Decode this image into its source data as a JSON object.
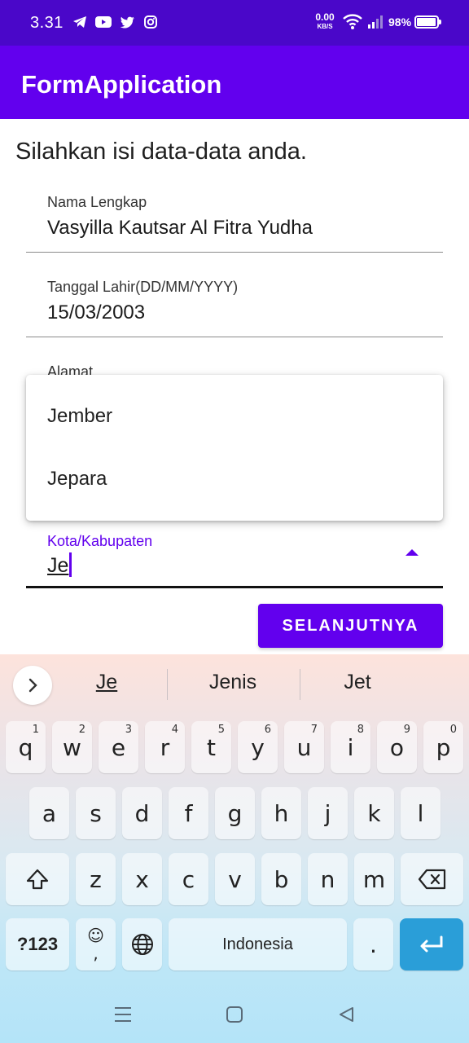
{
  "status_bar": {
    "time": "3.31",
    "net_speed_value": "0.00",
    "net_speed_unit": "KB/S",
    "battery": "98%",
    "icons": [
      "telegram-icon",
      "youtube-icon",
      "twitter-icon",
      "instagram-icon",
      "wifi-icon",
      "signal-icon",
      "battery-icon"
    ]
  },
  "app_bar": {
    "title": "FormApplication"
  },
  "form": {
    "heading": "Silahkan isi data-data anda.",
    "name": {
      "label": "Nama Lengkap",
      "value": "Vasyilla Kautsar Al Fitra Yudha"
    },
    "dob": {
      "label": "Tanggal Lahir(DD/MM/YYYY)",
      "value": "15/03/2003"
    },
    "address": {
      "label": "Alamat"
    },
    "city": {
      "label": "Kota/Kabupaten",
      "value": "Je"
    },
    "next_button": "SELANJUTNYA"
  },
  "dropdown": {
    "options": [
      "Jember",
      "Jepara"
    ]
  },
  "keyboard": {
    "suggestions": [
      "Je",
      "Jenis",
      "Jet"
    ],
    "row1": [
      "q",
      "w",
      "e",
      "r",
      "t",
      "y",
      "u",
      "i",
      "o",
      "p"
    ],
    "row1_hints": [
      "1",
      "2",
      "3",
      "4",
      "5",
      "6",
      "7",
      "8",
      "9",
      "0"
    ],
    "row2": [
      "a",
      "s",
      "d",
      "f",
      "g",
      "h",
      "j",
      "k",
      "l"
    ],
    "row3": [
      "z",
      "x",
      "c",
      "v",
      "b",
      "n",
      "m"
    ],
    "symbols_key": "?123",
    "comma_key": ",",
    "space_label": "Indonesia",
    "period_key": ".",
    "enter_color": "#2a9ed8"
  },
  "colors": {
    "status_bar": "#4a07c9",
    "primary": "#6200ee"
  }
}
